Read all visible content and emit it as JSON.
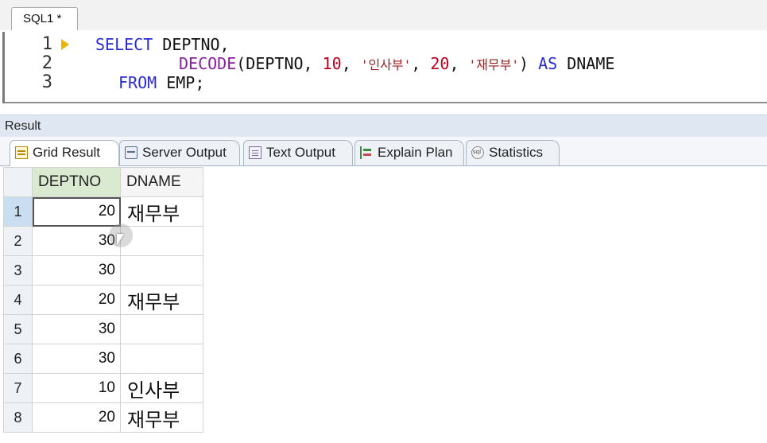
{
  "editor": {
    "tab_label": "SQL1 *",
    "lines": [
      {
        "number": "1",
        "segments": [
          [
            "kw",
            "SELECT"
          ],
          [
            "t",
            " DEPTNO,"
          ]
        ]
      },
      {
        "number": "2",
        "segments": [
          [
            "fn",
            "DECODE"
          ],
          [
            "t",
            "(DEPTNO, "
          ],
          [
            "num",
            "10"
          ],
          [
            "t",
            ", "
          ],
          [
            "str",
            "'인사부'"
          ],
          [
            "t",
            ", "
          ],
          [
            "num",
            "20"
          ],
          [
            "t",
            ", "
          ],
          [
            "str",
            "'재무부'"
          ],
          [
            "t",
            ") "
          ],
          [
            "kw",
            "AS"
          ],
          [
            "t",
            " DNAME"
          ]
        ]
      },
      {
        "number": "3",
        "segments": [
          [
            "kw",
            "FROM"
          ],
          [
            "t",
            " EMP;"
          ]
        ]
      }
    ]
  },
  "result": {
    "title": "Result",
    "tabs": [
      {
        "label": "Grid Result",
        "icon": "grid-icon",
        "active": true
      },
      {
        "label": "Server Output",
        "icon": "server-output-icon",
        "active": false
      },
      {
        "label": "Text Output",
        "icon": "text-output-icon",
        "active": false
      },
      {
        "label": "Explain Plan",
        "icon": "explain-plan-icon",
        "active": false
      },
      {
        "label": "Statistics",
        "icon": "statistics-icon",
        "active": false
      }
    ],
    "columns": [
      "DEPTNO",
      "DNAME"
    ],
    "rows": [
      {
        "num": "1",
        "deptno": "20",
        "dname": "재무부"
      },
      {
        "num": "2",
        "deptno": "30",
        "dname": ""
      },
      {
        "num": "3",
        "deptno": "30",
        "dname": ""
      },
      {
        "num": "4",
        "deptno": "20",
        "dname": "재무부"
      },
      {
        "num": "5",
        "deptno": "30",
        "dname": ""
      },
      {
        "num": "6",
        "deptno": "30",
        "dname": ""
      },
      {
        "num": "7",
        "deptno": "10",
        "dname": "인사부"
      },
      {
        "num": "8",
        "deptno": "20",
        "dname": "재무부"
      }
    ]
  }
}
